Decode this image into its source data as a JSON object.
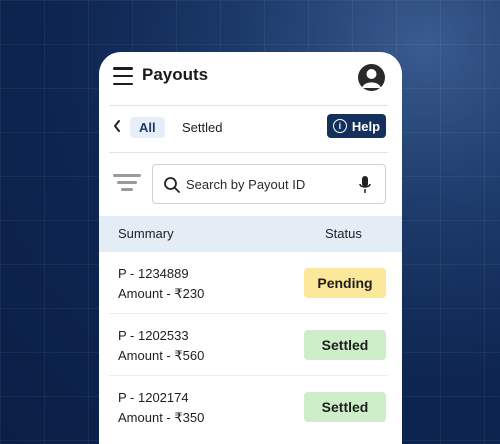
{
  "app": {
    "title": "Payouts"
  },
  "tabs": {
    "all": "All",
    "settled": "Settled"
  },
  "help": {
    "label": "Help",
    "icon_glyph": "i"
  },
  "search": {
    "placeholder": "Search by Payout ID"
  },
  "table": {
    "headers": {
      "summary": "Summary",
      "status": "Status"
    },
    "rows": [
      {
        "id": "P - 1234889",
        "amount": "Amount - ₹230",
        "status": "Pending",
        "status_color": "#fbe89a"
      },
      {
        "id": "P - 1202533",
        "amount": "Amount - ₹560",
        "status": "Settled",
        "status_color": "#cdeec8"
      },
      {
        "id": "P - 1202174",
        "amount": "Amount - ₹350",
        "status": "Settled",
        "status_color": "#cdeec8"
      }
    ]
  },
  "icons": [
    "menu-icon",
    "user-avatar-icon",
    "chevron-left-icon",
    "info-icon",
    "filter-icon",
    "search-icon",
    "microphone-icon"
  ],
  "colors": {
    "accent": "#14315e",
    "header_bg": "#e4ecf6",
    "tab_active_bg": "#e6eef8",
    "pending": "#fbe89a",
    "settled": "#cdeec8"
  }
}
